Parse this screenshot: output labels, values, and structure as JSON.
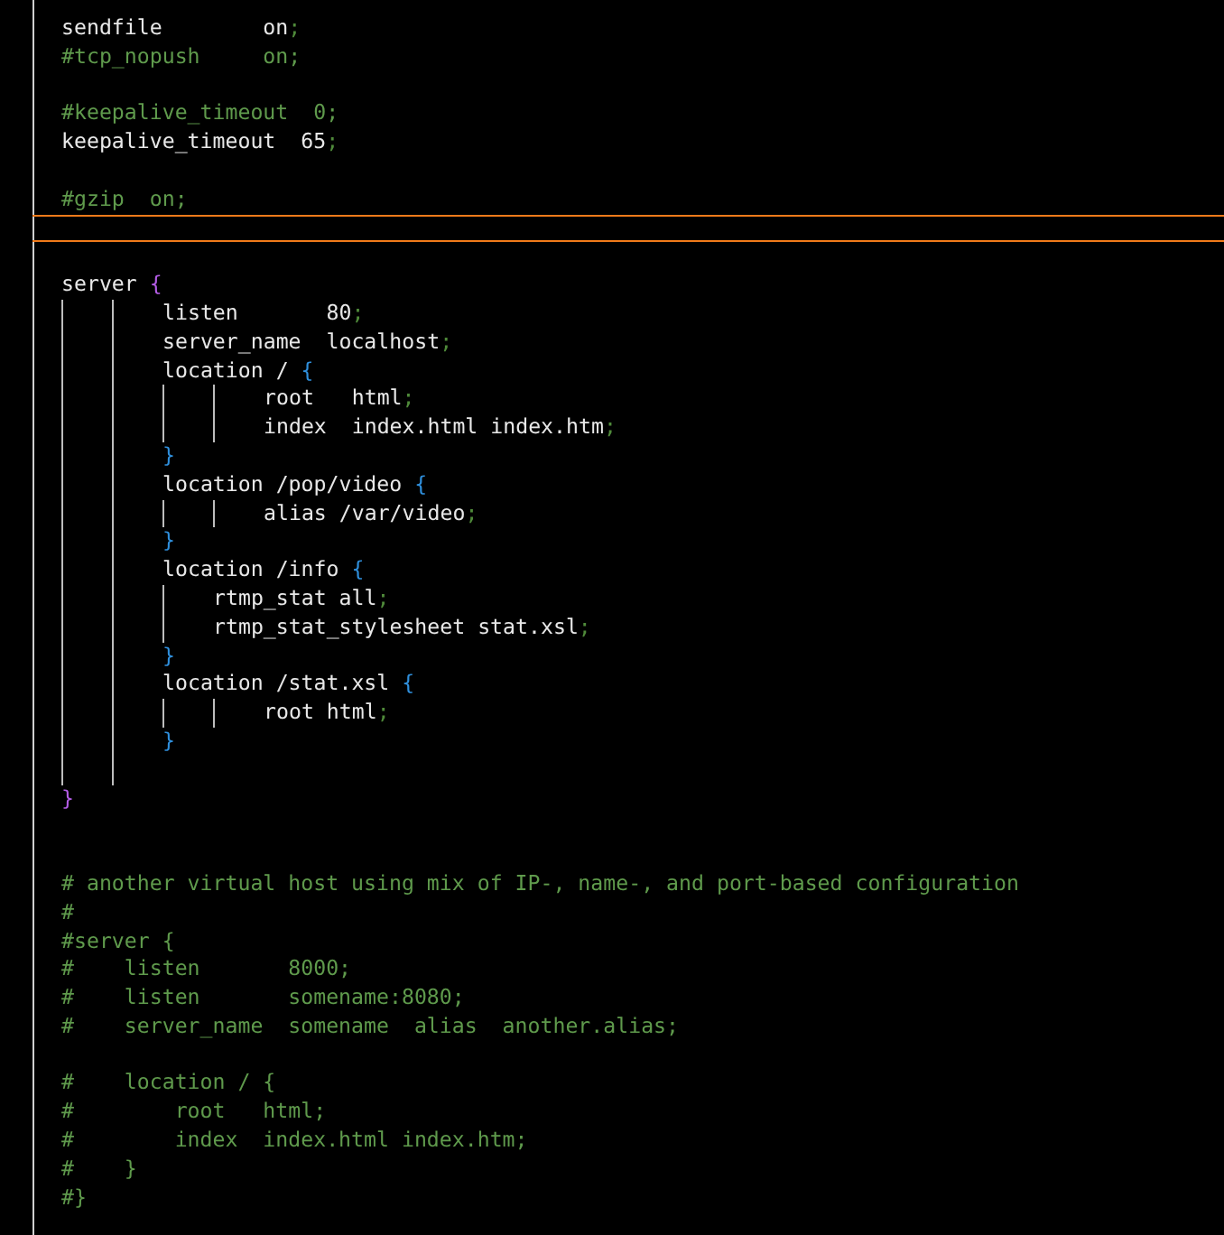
{
  "editor": {
    "lines": [
      {
        "tokens": [
          {
            "text": "sendfile        on"
          },
          {
            "text": ";",
            "kind": "punct"
          }
        ]
      },
      {
        "tokens": [
          {
            "text": "#tcp_nopush     on;",
            "kind": "comment"
          }
        ]
      },
      {
        "kind": "blank"
      },
      {
        "tokens": [
          {
            "text": "#keepalive_timeout  0;",
            "kind": "comment"
          }
        ]
      },
      {
        "tokens": [
          {
            "text": "keepalive_timeout  65"
          },
          {
            "text": ";",
            "kind": "punct"
          }
        ]
      },
      {
        "kind": "blank"
      },
      {
        "tokens": [
          {
            "text": "#gzip  on;",
            "kind": "comment"
          }
        ]
      },
      {
        "kind": "cursor"
      },
      {
        "kind": "blank"
      },
      {
        "tokens": [
          {
            "text": "server "
          },
          {
            "text": "{",
            "kind": "brace"
          }
        ],
        "kind": "tab",
        "children": [
          {
            "tokens": [
              {
                "text": "listen       80"
              },
              {
                "text": ";",
                "kind": "punct"
              }
            ]
          },
          {
            "tokens": [
              {
                "text": "server_name  localhost"
              },
              {
                "text": ";",
                "kind": "punct"
              }
            ]
          },
          {
            "tokens": [
              {
                "text": "location / "
              },
              {
                "text": "{",
                "kind": "brace"
              }
            ],
            "kind": "tab",
            "children": [
              {
                "tokens": [
                  {
                    "text": "root   html"
                  },
                  {
                    "text": ";",
                    "kind": "punct"
                  }
                ]
              },
              {
                "tokens": [
                  {
                    "text": "index  index.html index.htm"
                  },
                  {
                    "text": ";",
                    "kind": "punct"
                  }
                ]
              }
            ],
            "close": [
              {
                "text": "}",
                "kind": "brace"
              }
            ]
          },
          {
            "tokens": [
              {
                "text": "location /pop/video "
              },
              {
                "text": "{",
                "kind": "brace"
              }
            ],
            "kind": "tab",
            "children": [
              {
                "tokens": [
                  {
                    "text": "alias /var/video"
                  },
                  {
                    "text": ";",
                    "kind": "punct"
                  }
                ]
              }
            ],
            "close": [
              {
                "text": "}",
                "kind": "brace"
              }
            ]
          },
          {
            "tokens": [
              {
                "text": "location /info "
              },
              {
                "text": "{",
                "kind": "brace"
              }
            ],
            "kind": "spaces",
            "children": [
              {
                "tokens": [
                  {
                    "text": "rtmp_stat all"
                  },
                  {
                    "text": ";",
                    "kind": "punct"
                  }
                ]
              },
              {
                "tokens": [
                  {
                    "text": "rtmp_stat_stylesheet stat.xsl"
                  },
                  {
                    "text": ";",
                    "kind": "punct"
                  }
                ]
              }
            ],
            "close": [
              {
                "text": "}",
                "kind": "brace"
              }
            ]
          },
          {
            "tokens": [
              {
                "text": "location /stat.xsl "
              },
              {
                "text": "{",
                "kind": "brace"
              }
            ],
            "kind": "tab",
            "children": [
              {
                "tokens": [
                  {
                    "text": "root html"
                  },
                  {
                    "text": ";",
                    "kind": "punct"
                  }
                ]
              }
            ],
            "close": [
              {
                "text": "}",
                "kind": "brace"
              }
            ]
          },
          {
            "kind": "blank"
          }
        ],
        "close": [
          {
            "text": "}",
            "kind": "brace"
          }
        ]
      },
      {
        "kind": "blank"
      },
      {
        "kind": "blank"
      },
      {
        "tokens": [
          {
            "text": "# another virtual host using mix of IP-, name-, and port-based configuration",
            "kind": "comment"
          }
        ]
      },
      {
        "tokens": [
          {
            "text": "#",
            "kind": "comment"
          }
        ]
      },
      {
        "tokens": [
          {
            "text": "#server {",
            "kind": "comment"
          }
        ]
      },
      {
        "tokens": [
          {
            "text": "#    listen       8000;",
            "kind": "comment"
          }
        ]
      },
      {
        "tokens": [
          {
            "text": "#    listen       somename:8080;",
            "kind": "comment"
          }
        ]
      },
      {
        "tokens": [
          {
            "text": "#    server_name  somename  alias  another.alias;",
            "kind": "comment"
          }
        ]
      },
      {
        "kind": "blank"
      },
      {
        "tokens": [
          {
            "text": "#    location / {",
            "kind": "comment"
          }
        ]
      },
      {
        "tokens": [
          {
            "text": "#        root   html;",
            "kind": "comment"
          }
        ]
      },
      {
        "tokens": [
          {
            "text": "#        index  index.html index.htm;",
            "kind": "comment"
          }
        ]
      },
      {
        "tokens": [
          {
            "text": "#    }",
            "kind": "comment"
          }
        ]
      },
      {
        "tokens": [
          {
            "text": "#}",
            "kind": "comment"
          }
        ]
      }
    ]
  }
}
